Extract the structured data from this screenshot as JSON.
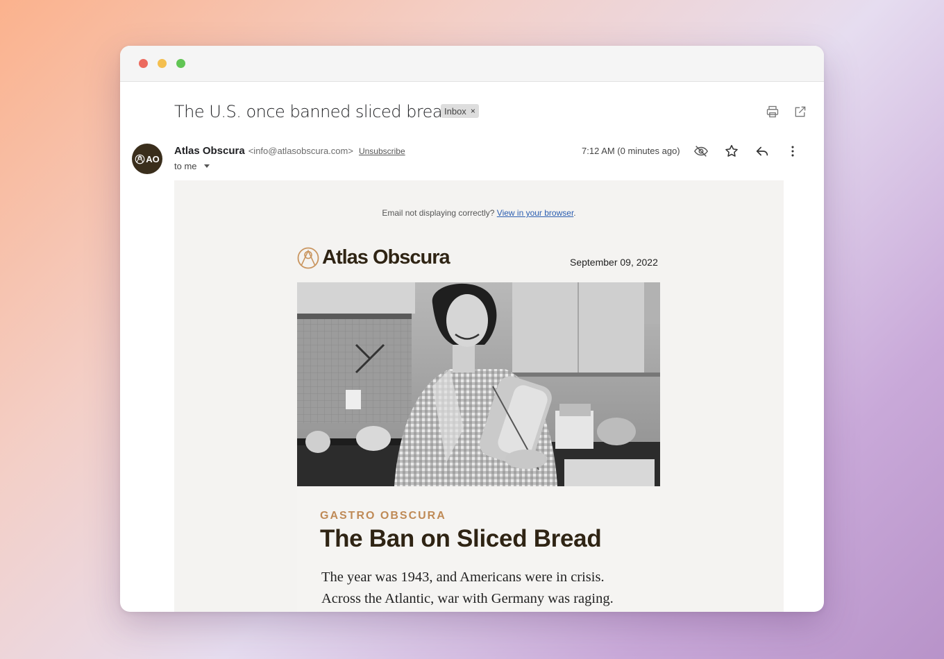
{
  "window": {
    "controls": [
      "close",
      "minimize",
      "maximize"
    ]
  },
  "message": {
    "subject": "The U.S. once banned sliced bread",
    "label": "Inbox",
    "label_remove": "×",
    "sender_name": "Atlas Obscura",
    "sender_email": "<info@atlasobscura.com>",
    "unsubscribe": "Unsubscribe",
    "recipient": "to me",
    "timestamp": "7:12 AM (0 minutes ago)",
    "avatar_initials": "AO"
  },
  "actions": {
    "print": "printer-icon",
    "open_new_window": "open-in-new-icon",
    "hide_images": "eye-off-icon",
    "star": "star-icon",
    "reply": "reply-icon",
    "more": "more-vertical-icon"
  },
  "newsletter": {
    "notice_text": "Email not displaying correctly? ",
    "notice_link": "View in your browser",
    "notice_end": ".",
    "brand": "Atlas Obscura",
    "date": "September 09, 2022",
    "hero_image": "1950s woman in kitchen holding loaves of sliced bread",
    "kicker": "GASTRO OBSCURA",
    "headline": "The Ban on Sliced Bread",
    "lede_line1": "The year was 1943, and Americans were in crisis.",
    "lede_line2": "Across the Atlantic, war with Germany was raging."
  },
  "colors": {
    "brand_dark": "#2f2414",
    "kicker": "#bf8a56",
    "link": "#2a5db0",
    "close_dot": "#ec6a5e",
    "minimize_dot": "#f4bf4f",
    "maximize_dot": "#61c554"
  }
}
